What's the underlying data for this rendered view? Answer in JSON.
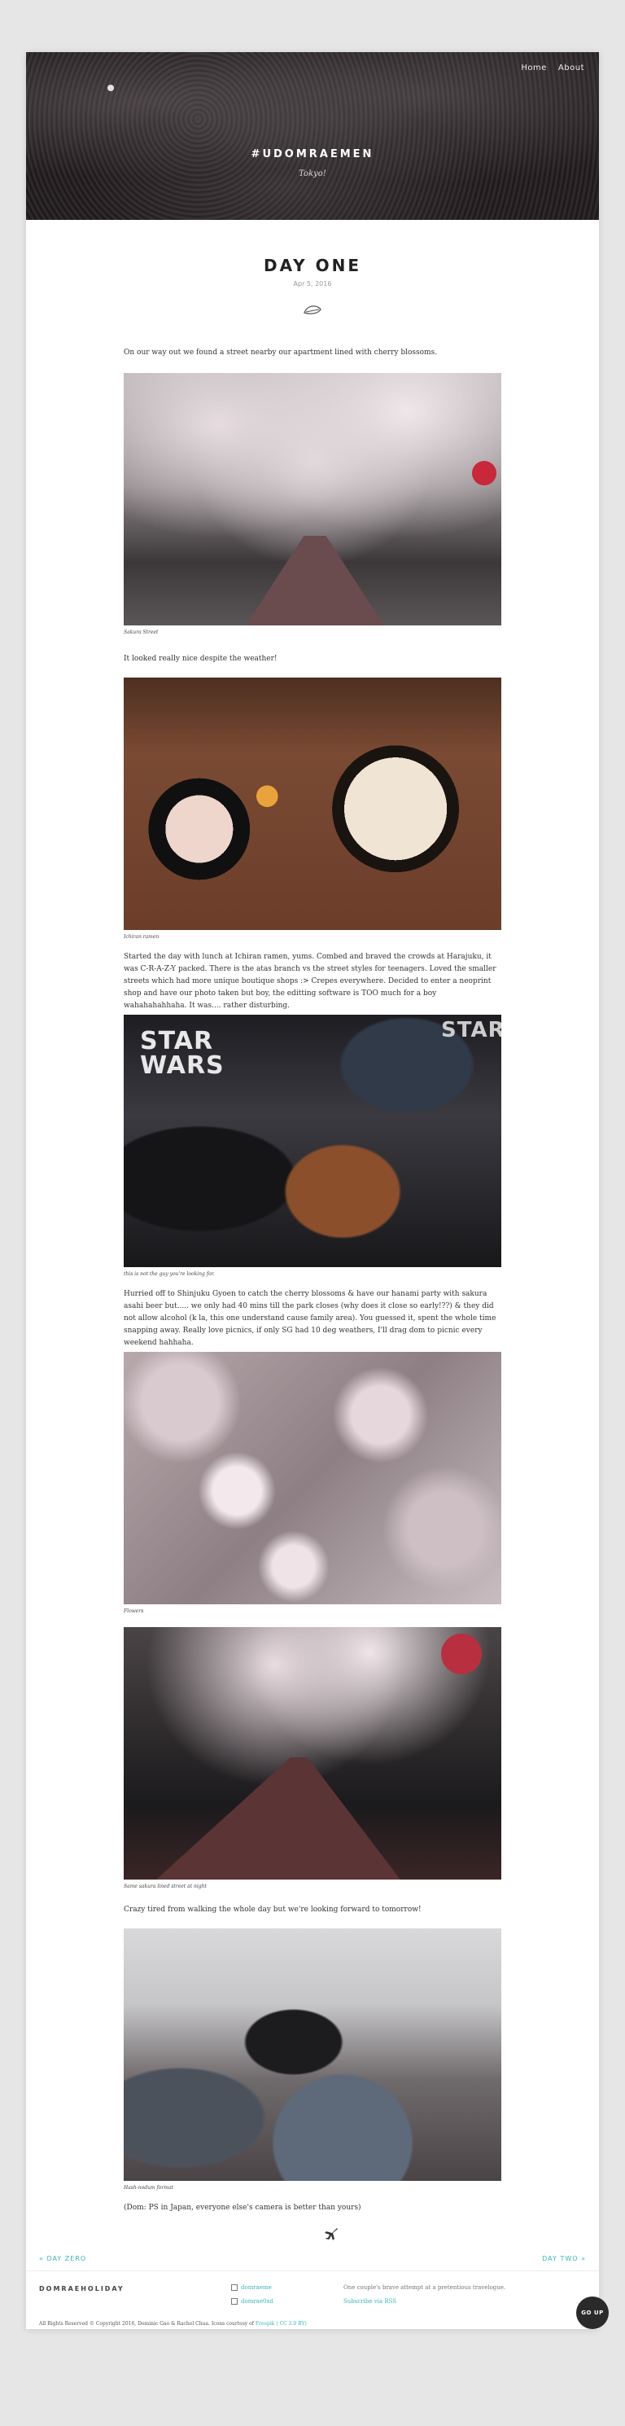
{
  "header": {
    "title": "#UDOMRAEMEN",
    "subtitle": "Tokyo!",
    "nav": [
      "Home",
      "About"
    ]
  },
  "post": {
    "title": "DAY ONE",
    "date": "Apr 5, 2016",
    "paragraphs": {
      "p1": "On our way out we found a street nearby our apartment lined with cherry blossoms.",
      "p2": "It looked really nice despite the weather!",
      "p3": "Started the day with lunch at Ichiran ramen, yums. Combed and braved the crowds at Harajuku, it was C-R-A-Z-Y packed. There is the atas branch vs the street styles for teenagers. Loved the smaller streets which had more unique boutique shops :> Crepes everywhere. Decided to enter a neoprint shop and have our photo taken but boy, the editting software is TOO much for a boy wahahahahhaha. It was.... rather disturbing.",
      "p4": "Hurried off to Shinjuku Gyoen to catch the cherry blossoms & have our hanami party with sakura asahi beer but..... we only had 40 mins till the park closes (why does it close so early!??) & they did not allow alcohol (k la, this one understand cause family area). You guessed it, spent the whole time snapping away. Really love picnics, if only SG had 10 deg weathers, I'll drag dom to picnic every weekend hahhaha.",
      "p5": "Crazy tired from walking the whole day but we're looking forward to tomorrow!",
      "p6": "(Dom: PS in Japan, everyone else's camera is better than yours)"
    },
    "captions": {
      "c1": "Sakura Street",
      "c2": "Ichiran ramen",
      "c3": "this is not the guy you're looking for.",
      "c4": "Flowers",
      "c5": "Same sakura lined street at night",
      "c6": "Hash-nodum format"
    }
  },
  "footer": {
    "prev": "« DAY ZERO",
    "next": "DAY TWO »",
    "site_name": "DOMRAEHOLIDAY",
    "social": [
      "domraeme",
      "domrae0xd"
    ],
    "about_text": "One couple's brave attempt at a pretentious travelogue.",
    "subscribe": "Subscribe via RSS",
    "copyright_text": "All Rights Reserved © Copyright 2016, Dominic Gao & Rachel Chua. Icons courtesy of",
    "copyright_link": "Freepik",
    "copyright_tail": "( CC 3.0 BY)",
    "go_up": "GO UP"
  },
  "colors": {
    "accent": "#3bb5b8",
    "background": "#e6e6e6"
  },
  "icons": [
    "leaf-icon",
    "plane-icon",
    "twitter-icon",
    "instagram-icon"
  ]
}
